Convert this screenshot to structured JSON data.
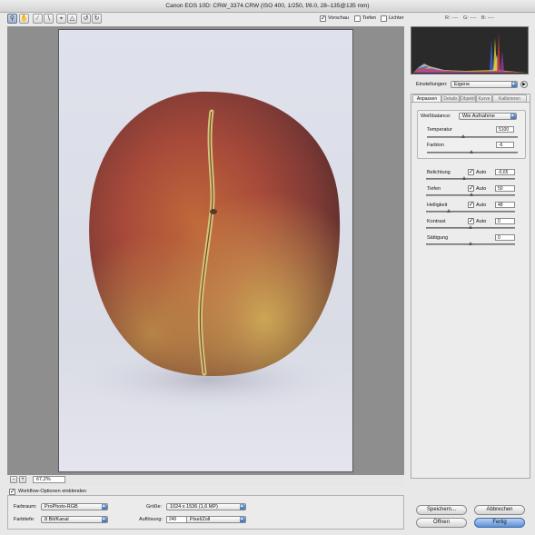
{
  "window": {
    "title": "Canon EOS 10D:  CRW_3374.CRW  (ISO 400, 1/250, f/8.0, 28–135@135 mm)"
  },
  "toolbar": {
    "tools": [
      "zoom-icon",
      "hand-icon",
      "eyedropper-icon",
      "color-sampler-icon",
      "crop-icon",
      "straighten-icon",
      "rotate-left-icon",
      "rotate-right-icon"
    ],
    "preview_label": "Vorschau",
    "shadows_label": "Tiefen",
    "highlights_label": "Lichter",
    "rgb_r": "R: ----",
    "rgb_g": "G: ----",
    "rgb_b": "B: ----"
  },
  "zoom": {
    "minus": "−",
    "plus": "+",
    "value": "67,2%"
  },
  "workflow": {
    "toggle_label": "Workflow-Optionen einblenden",
    "farbraum_label": "Farbraum:",
    "farbraum_value": "ProPhoto-RGB",
    "farbtiefe_label": "Farbtiefe:",
    "farbtiefe_value": "8 Bit/Kanal",
    "groesse_label": "Größe:",
    "groesse_value": "1024 x 1536 (1,6 MP)",
    "aufloesung_label": "Auflösung:",
    "aufloesung_value": "240",
    "einheit_value": "Pixel/Zoll"
  },
  "settings": {
    "label": "Einstellungen:",
    "value": "Eigene"
  },
  "tabs": [
    "Anpassen",
    "Details",
    "Objektiv",
    "Kurve",
    "Kalibrieren"
  ],
  "whitebalance": {
    "label": "Weißbalance:",
    "value": "Wie Aufnahme",
    "temperatur_label": "Temperatur",
    "temperatur_value": "5100",
    "farbton_label": "Farbton",
    "farbton_value": "-6"
  },
  "adjust": {
    "auto_label": "Auto",
    "belichtung_label": "Belichtung",
    "belichtung_value": "-0,65",
    "tiefen_label": "Tiefen",
    "tiefen_value": "50",
    "helligkeit_label": "Helligkeit",
    "helligkeit_value": "48",
    "kontrast_label": "Kontrast",
    "kontrast_value": "0",
    "saettigung_label": "Sättigung",
    "saettigung_value": "0"
  },
  "buttons": {
    "speichern": "Speichern...",
    "abbrechen": "Abbrechen",
    "oeffnen": "Öffnen",
    "fertig": "Fertig"
  },
  "colors": {
    "accent": "#5c8fd6",
    "preview_bg": "#8e8e8e"
  }
}
